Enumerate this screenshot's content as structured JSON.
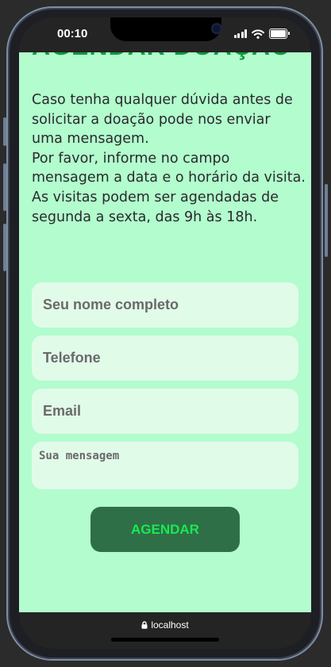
{
  "status_bar": {
    "time": "00:10",
    "icons": [
      "cellular-signal-icon",
      "wifi-icon",
      "battery-icon"
    ]
  },
  "page": {
    "heading": "AGENDAR DOAÇÃO",
    "intro_lines": [
      "Caso tenha qualquer dúvida antes de",
      "solicitar a doação pode nos enviar",
      "uma mensagem.",
      "Por favor, informe no campo",
      "mensagem a data e o horário da visita.",
      "As visitas podem ser agendadas de",
      "segunda a sexta, das 9h às 18h."
    ]
  },
  "form": {
    "name_placeholder": "Seu nome completo",
    "phone_placeholder": "Telefone",
    "email_placeholder": "Email",
    "message_placeholder": "Sua mensagem",
    "submit_label": "AGENDAR"
  },
  "browser": {
    "url": "localhost"
  },
  "colors": {
    "page_background": "#b2fcce",
    "heading": "#119a3c",
    "field_background": "#e1fbe9",
    "button_background": "#2f6f47",
    "button_text": "#18ea53"
  }
}
